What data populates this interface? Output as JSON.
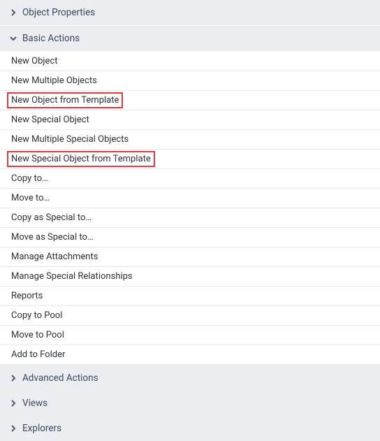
{
  "sections": {
    "object_properties": {
      "title": "Object Properties"
    },
    "basic_actions": {
      "title": "Basic Actions",
      "items": [
        {
          "label": "New Object",
          "highlighted": false
        },
        {
          "label": "New Multiple Objects",
          "highlighted": false
        },
        {
          "label": "New Object from Template",
          "highlighted": true
        },
        {
          "label": "New Special Object",
          "highlighted": false
        },
        {
          "label": "New Multiple Special Objects",
          "highlighted": false
        },
        {
          "label": "New Special Object from Template",
          "highlighted": true
        },
        {
          "label": "Copy to…",
          "highlighted": false
        },
        {
          "label": "Move to…",
          "highlighted": false
        },
        {
          "label": "Copy as Special to…",
          "highlighted": false
        },
        {
          "label": "Move as Special to…",
          "highlighted": false
        },
        {
          "label": "Manage Attachments",
          "highlighted": false
        },
        {
          "label": "Manage Special Relationships",
          "highlighted": false
        },
        {
          "label": "Reports",
          "highlighted": false
        },
        {
          "label": "Copy to Pool",
          "highlighted": false
        },
        {
          "label": "Move to Pool",
          "highlighted": false
        },
        {
          "label": "Add to Folder",
          "highlighted": false
        }
      ]
    },
    "advanced_actions": {
      "title": "Advanced Actions"
    },
    "views": {
      "title": "Views"
    },
    "explorers": {
      "title": "Explorers"
    }
  }
}
